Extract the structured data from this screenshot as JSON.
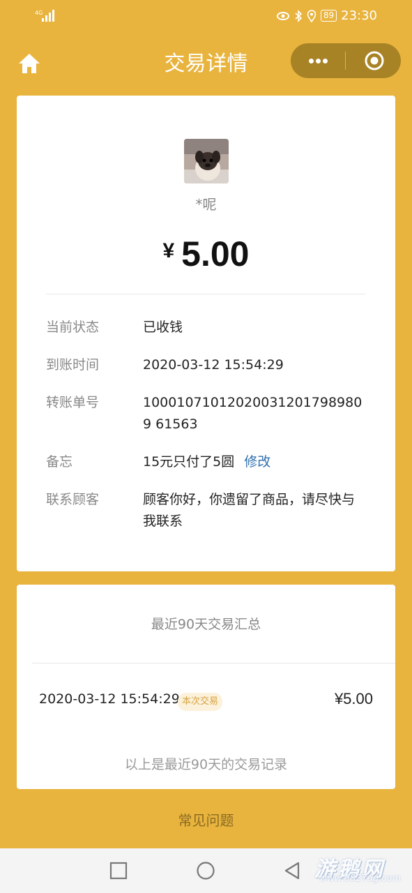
{
  "status_bar": {
    "network": "4G",
    "battery": "89",
    "time": "23:30"
  },
  "nav": {
    "title": "交易详情"
  },
  "payer": {
    "nickname": "*呢"
  },
  "amount": {
    "currency": "¥",
    "value": "5.00"
  },
  "details": [
    {
      "label": "当前状态",
      "value": "已收钱"
    },
    {
      "label": "到账时间",
      "value": "2020-03-12 15:54:29"
    },
    {
      "label": "转账单号",
      "value": "100010710120200312017989809 61563"
    },
    {
      "label": "备忘",
      "value": "15元只付了5圆",
      "link": "修改"
    },
    {
      "label": "联系顾客",
      "value": "顾客你好，你遗留了商品，请尽快与我联系"
    }
  ],
  "summary": {
    "title": "最近90天交易汇总",
    "transaction": {
      "time": "2020-03-12 15:54:29",
      "badge": "本次交易",
      "amount": "¥5.00"
    },
    "footnote": "以上是最近90天的交易记录"
  },
  "faq": "常见问题",
  "watermark": {
    "main": "游鹅网",
    "sub": "www.0827ug.com"
  },
  "colors": {
    "background": "#E8B43E",
    "link": "#2F6FAE",
    "badge": "#D6A340"
  }
}
